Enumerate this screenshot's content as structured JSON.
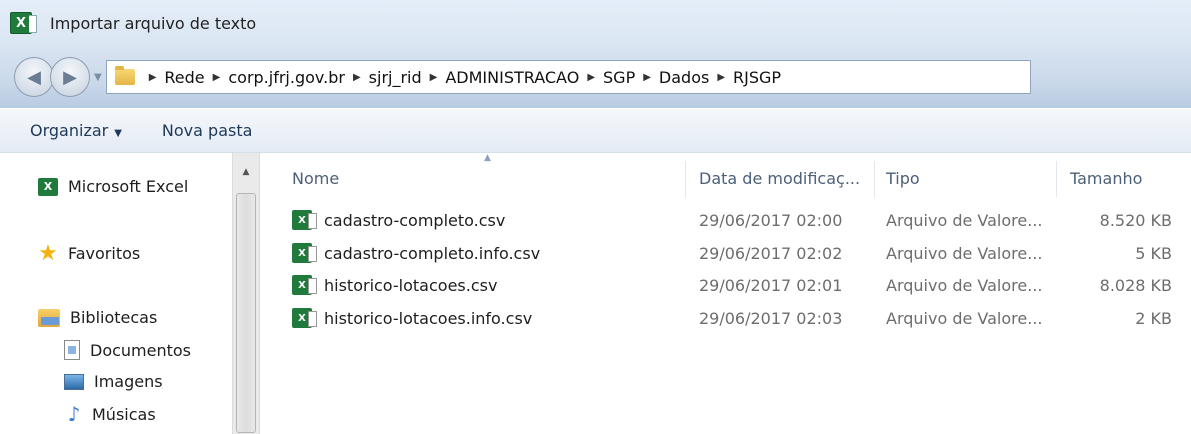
{
  "window": {
    "title": "Importar arquivo de texto"
  },
  "breadcrumb": [
    "Rede",
    "corp.jfrj.gov.br",
    "sjrj_rid",
    "ADMINISTRACAO",
    "SGP",
    "Dados",
    "RJSGP"
  ],
  "toolbar": {
    "organize_label": "Organizar",
    "new_folder_label": "Nova pasta"
  },
  "sidebar": {
    "items": [
      {
        "label": "Microsoft Excel",
        "icon": "excel-icon"
      },
      {
        "label": "Favoritos",
        "icon": "star-icon"
      },
      {
        "label": "Bibliotecas",
        "icon": "libraries-icon"
      },
      {
        "label": "Documentos",
        "icon": "documents-icon"
      },
      {
        "label": "Imagens",
        "icon": "pictures-icon"
      },
      {
        "label": "Músicas",
        "icon": "music-icon"
      }
    ]
  },
  "columns": {
    "name": "Nome",
    "modified": "Data de modificaç...",
    "type": "Tipo",
    "size": "Tamanho"
  },
  "files": [
    {
      "name": "cadastro-completo.csv",
      "modified": "29/06/2017 02:00",
      "type": "Arquivo de Valore...",
      "size": "8.520 KB"
    },
    {
      "name": "cadastro-completo.info.csv",
      "modified": "29/06/2017 02:02",
      "type": "Arquivo de Valore...",
      "size": "5 KB"
    },
    {
      "name": "historico-lotacoes.csv",
      "modified": "29/06/2017 02:01",
      "type": "Arquivo de Valore...",
      "size": "8.028 KB"
    },
    {
      "name": "historico-lotacoes.info.csv",
      "modified": "29/06/2017 02:03",
      "type": "Arquivo de Valore...",
      "size": "2 KB"
    }
  ]
}
